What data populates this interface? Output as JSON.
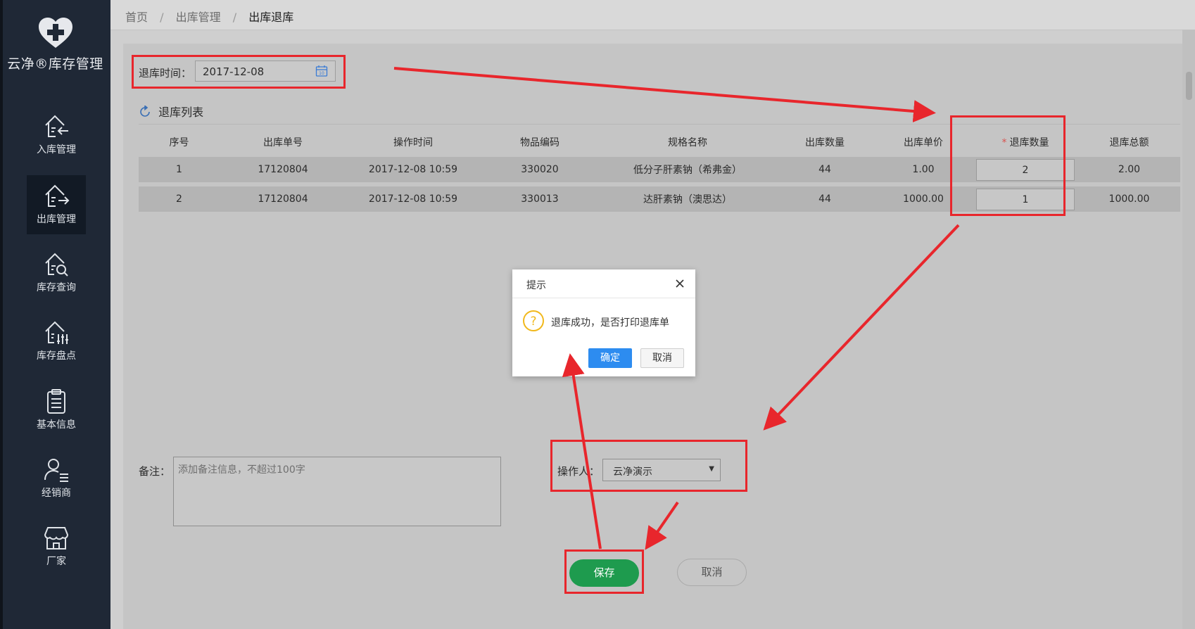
{
  "app": {
    "title": "云净®库存管理"
  },
  "sidebar": {
    "items": [
      {
        "label": "入库管理",
        "icon": "house-arrow-in-icon",
        "active": false
      },
      {
        "label": "出库管理",
        "icon": "house-arrow-out-icon",
        "active": true
      },
      {
        "label": "库存查询",
        "icon": "house-search-icon",
        "active": false
      },
      {
        "label": "库存盘点",
        "icon": "house-sliders-icon",
        "active": false
      },
      {
        "label": "基本信息",
        "icon": "clipboard-icon",
        "active": false
      },
      {
        "label": "经销商",
        "icon": "user-list-icon",
        "active": false
      },
      {
        "label": "厂家",
        "icon": "storefront-icon",
        "active": false
      }
    ]
  },
  "breadcrumb": {
    "items": [
      "首页",
      "出库管理"
    ],
    "current": "出库退库",
    "separator": "/"
  },
  "form": {
    "date_label": "退库时间：",
    "date_value": "2017-12-08",
    "list_title": "退库列表",
    "remark_label": "备注：",
    "remark_placeholder": "添加备注信息，不超过100字",
    "operator_label": "操作人：",
    "operator_value": "云净演示",
    "save_label": "保存",
    "cancel_label": "取消"
  },
  "table": {
    "required_mark": "*",
    "headers": [
      "序号",
      "出库单号",
      "操作时间",
      "物品编码",
      "规格名称",
      "出库数量",
      "出库单价",
      "退库数量",
      "退库总额"
    ],
    "rows": [
      [
        "1",
        "17120804",
        "2017-12-08 10:59",
        "330020",
        "低分子肝素钠（希弗金）",
        "44",
        "1.00",
        "2",
        "2.00"
      ],
      [
        "2",
        "17120804",
        "2017-12-08 10:59",
        "330013",
        "达肝素钠（澳思达）",
        "44",
        "1000.00",
        "1",
        "1000.00"
      ]
    ]
  },
  "dialog": {
    "title": "提示",
    "message": "退库成功，是否打印退库单",
    "ok_label": "确定",
    "cancel_label": "取消"
  },
  "colors": {
    "sidebar_bg": "#1f2836",
    "save_green": "#1e9b4e",
    "dialog_ok_blue": "#2d8cf0",
    "annotation_red": "#e8262c"
  }
}
